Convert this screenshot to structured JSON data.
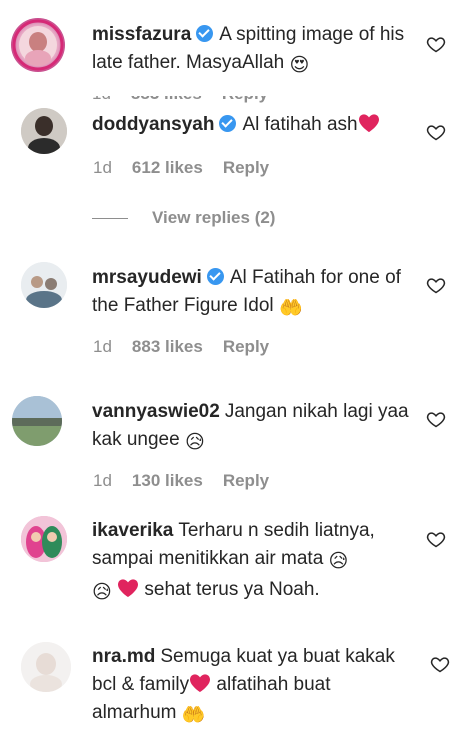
{
  "comments": [
    {
      "username": "missfazura",
      "verified": true,
      "text": "A spitting image of his late father. MasyaAllah",
      "emoji": "😍"
    },
    {
      "username": "doddyansyah",
      "verified": true,
      "text": "Al fatihah ash",
      "emoji": "❤",
      "time": "1d",
      "likes": "612 likes",
      "reply": "Reply"
    },
    {
      "username": "mrsayudewi",
      "verified": true,
      "text": "Al Fatihah for one of the Father Figure Idol",
      "emoji": "🤲",
      "time": "1d",
      "likes": "883 likes",
      "reply": "Reply"
    },
    {
      "username": "vannyaswie02",
      "verified": false,
      "text": "Jangan nikah lagi yaa kak ungee",
      "emoji": "😥",
      "time": "1d",
      "likes": "130 likes",
      "reply": "Reply"
    },
    {
      "username": "ikaverika",
      "verified": false,
      "text": "Terharu n sedih liatnya, sampai menitikkan air mata",
      "emoji": "😥",
      "text2": "sehat terus ya Noah."
    },
    {
      "username": "nra.md",
      "verified": false,
      "text": "Semuga kuat ya buat kakak bcl & family",
      "text2": "alfatihah buat almarhum",
      "emoji": "🤲"
    }
  ],
  "view_replies": "View replies (2)",
  "colors": {
    "verified": "#3897f0",
    "muted": "#8e8e8e",
    "heart_red": "#e0245e"
  }
}
